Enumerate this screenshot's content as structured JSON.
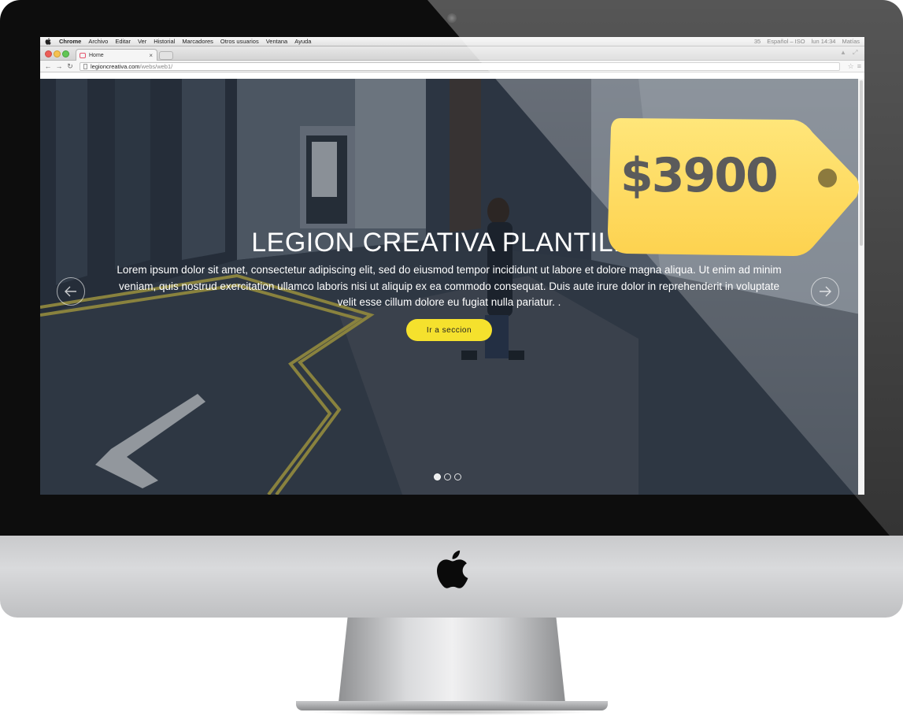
{
  "menubar": {
    "app": "Chrome",
    "items": [
      "Archivo",
      "Editar",
      "Ver",
      "Historial",
      "Marcadores",
      "Otros usuarios",
      "Ventana",
      "Ayuda"
    ],
    "status_battery": "35",
    "status_language": "Español – ISO",
    "status_clock": "lun 14:34",
    "status_user": "Matías"
  },
  "browser": {
    "tab_title": "Home",
    "tab_close": "×",
    "url_domain": "legioncreativa.com",
    "url_path": "/webs/web1/"
  },
  "hero": {
    "title": "LEGION CREATIVA PLANTILLA",
    "text": "Lorem ipsum dolor sit amet, consectetur adipiscing elit, sed do eiusmod tempor incididunt ut labore et dolore magna aliqua. Ut enim ad minim veniam, quis nostrud exercitation ullamco laboris nisi ut aliquip ex ea commodo consequat. Duis aute irure dolor in reprehenderit in voluptate velit esse cillum dolore eu fugiat nulla pariatur. .",
    "cta_label": "Ir a seccion",
    "slide_count": 3,
    "active_slide": 1
  },
  "price_tag": {
    "price": "$3900",
    "color": "#FDDB5A",
    "text_color": "#5B5B5B"
  },
  "icons": [
    "apple-logo-icon",
    "chevron-left-icon",
    "chevron-right-icon",
    "star-icon",
    "menu-icon",
    "reload-icon"
  ]
}
